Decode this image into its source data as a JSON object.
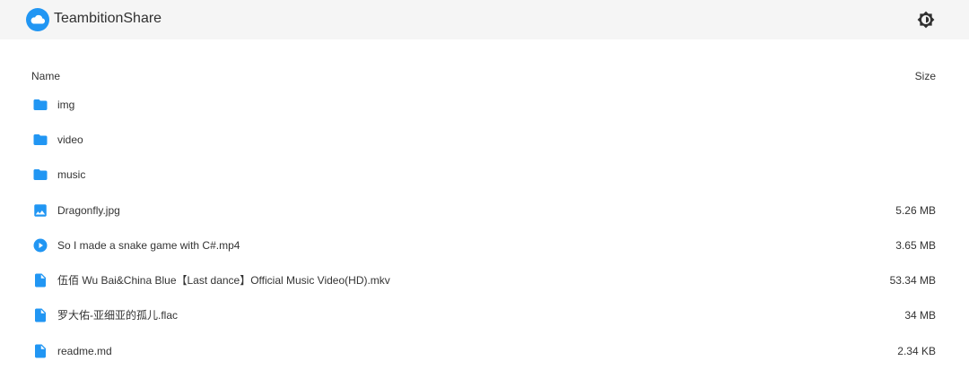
{
  "app": {
    "title": "TeambitionShare",
    "accent": "#2196f3",
    "theme_icon": "brightness-icon"
  },
  "table": {
    "headers": {
      "name": "Name",
      "size": "Size"
    },
    "rows": [
      {
        "name": "img",
        "size": "",
        "icon": "folder-icon"
      },
      {
        "name": "video",
        "size": "",
        "icon": "folder-icon"
      },
      {
        "name": "music",
        "size": "",
        "icon": "folder-icon"
      },
      {
        "name": "Dragonfly.jpg",
        "size": "5.26 MB",
        "icon": "image-icon"
      },
      {
        "name": "So I made a snake game with C#.mp4",
        "size": "3.65 MB",
        "icon": "play-circle-icon"
      },
      {
        "name": "伍佰 Wu Bai&China Blue【Last dance】Official Music Video(HD).mkv",
        "size": "53.34 MB",
        "icon": "file-icon"
      },
      {
        "name": "罗大佑-亚细亚的孤儿.flac",
        "size": "34 MB",
        "icon": "file-icon"
      },
      {
        "name": "readme.md",
        "size": "2.34 KB",
        "icon": "file-icon"
      }
    ]
  }
}
